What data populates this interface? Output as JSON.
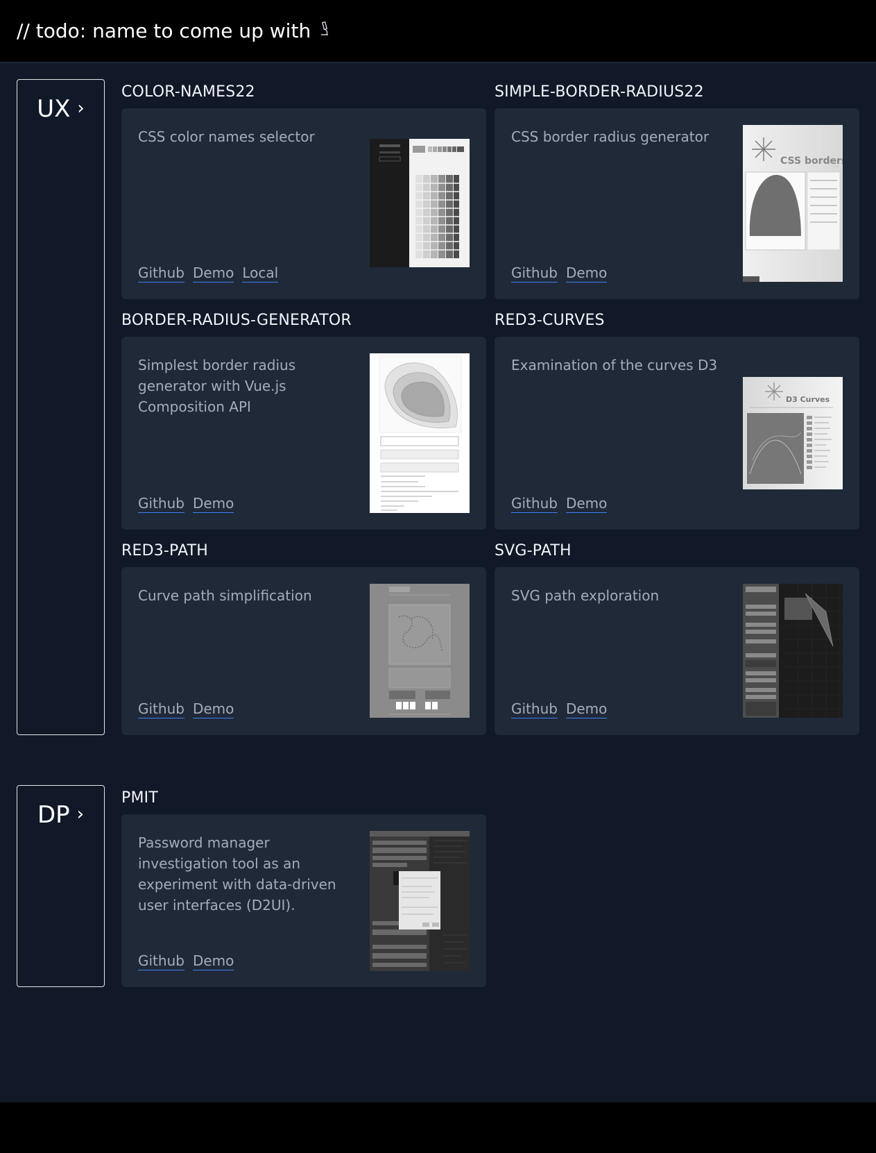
{
  "header": {
    "title": "// todo: name to come up with",
    "icon": "microscope-icon"
  },
  "sections": [
    {
      "label": "UX",
      "projects": [
        {
          "title": "COLOR-NAMES22",
          "description": "CSS color names selector",
          "links": [
            "Github",
            "Demo",
            "Local"
          ]
        },
        {
          "title": "SIMPLE-BORDER-RADIUS22",
          "description": "CSS border radius generator",
          "links": [
            "Github",
            "Demo"
          ],
          "thumb_heading": "CSS borders"
        },
        {
          "title": "BORDER-RADIUS-GENERATOR",
          "description": "Simplest border radius generator with Vue.js Composition API",
          "links": [
            "Github",
            "Demo"
          ]
        },
        {
          "title": "RED3-CURVES",
          "description": "Examination of the curves D3",
          "links": [
            "Github",
            "Demo"
          ],
          "thumb_heading": "D3 Curves"
        },
        {
          "title": "RED3-PATH",
          "description": "Curve path simplification",
          "links": [
            "Github",
            "Demo"
          ]
        },
        {
          "title": "SVG-PATH",
          "description": "SVG path exploration",
          "links": [
            "Github",
            "Demo"
          ]
        }
      ]
    },
    {
      "label": "DP",
      "projects": [
        {
          "title": "PMIT",
          "description": "Password manager investigation tool as an experiment with data-driven user interfaces (D2UI).",
          "links": [
            "Github",
            "Demo"
          ]
        }
      ]
    }
  ],
  "colors": {
    "page_bg": "#111827",
    "card_bg": "#1f2937",
    "header_bg": "#000000",
    "link_underline": "#3b82f6",
    "muted_text": "#a4adbc"
  }
}
